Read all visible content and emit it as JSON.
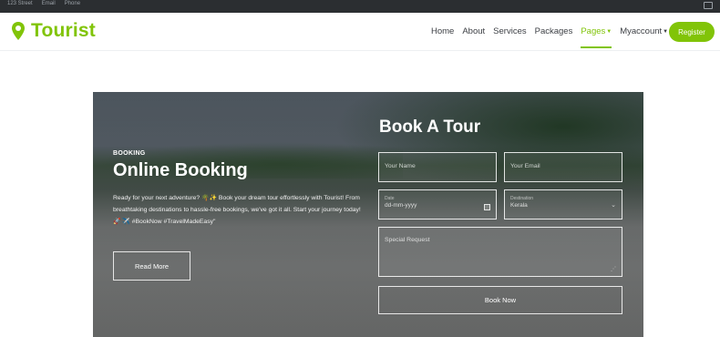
{
  "topbar": {
    "links": [
      "123 Street",
      "Email",
      "Phone"
    ]
  },
  "brand": {
    "name": "Tourist",
    "color": "#81c408"
  },
  "nav": {
    "items": [
      {
        "label": "Home"
      },
      {
        "label": "About"
      },
      {
        "label": "Services"
      },
      {
        "label": "Packages"
      },
      {
        "label": "Pages"
      },
      {
        "label": "Myaccount"
      }
    ],
    "register": "Register"
  },
  "hero": {
    "eyebrow": "BOOKING",
    "title": "Online Booking",
    "description": "Ready for your next adventure? 🌴✨ Book your dream tour effortlessly with Tourist! From breathtaking destinations to hassle-free bookings, we've got it all. Start your journey today! 🚀 ✈️ #BookNow #TravelMadeEasy\"",
    "read_more": "Read More"
  },
  "form": {
    "title": "Book A Tour",
    "name_placeholder": "Your Name",
    "email_placeholder": "Your Email",
    "date_label": "Date",
    "date_value": "dd-mm-yyyy",
    "destination_label": "Destination",
    "destination_value": "Kerala",
    "request_placeholder": "Special Request",
    "submit": "Book Now"
  }
}
